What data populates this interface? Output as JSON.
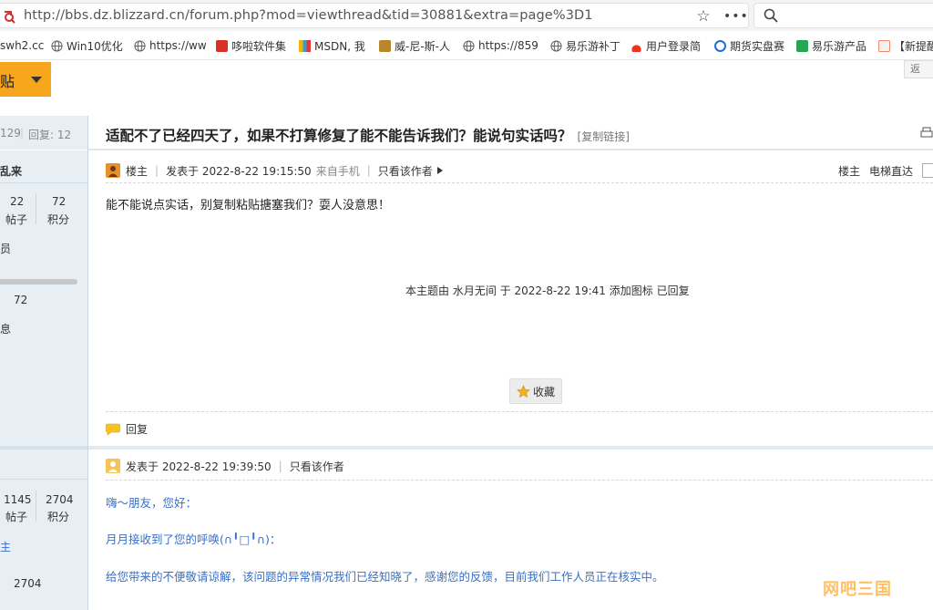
{
  "browser": {
    "url": "http://bbs.dz.blizzard.cn/forum.php?mod=viewthread&tid=30881&extra=page%3D1",
    "more_label": "•••",
    "bookmarks": [
      {
        "label": "swh2.cc",
        "icon": "partial-icon"
      },
      {
        "label": "Win10优化",
        "icon": "globe-icon"
      },
      {
        "label": "https://ww",
        "icon": "globe-icon"
      },
      {
        "label": "哆啦软件集",
        "icon": "duola-icon"
      },
      {
        "label": "MSDN, 我",
        "icon": "msdn-icon"
      },
      {
        "label": "威-尼-斯-人",
        "icon": "ship-icon"
      },
      {
        "label": "https://859",
        "icon": "globe-icon"
      },
      {
        "label": "易乐游补丁",
        "icon": "globe-icon"
      },
      {
        "label": "用户登录简",
        "icon": "huawei-icon"
      },
      {
        "label": "期货实盘赛",
        "icon": "futures-icon"
      },
      {
        "label": "易乐游产品",
        "icon": "green-icon"
      },
      {
        "label": "【新提醒",
        "icon": "site58-icon"
      }
    ]
  },
  "page": {
    "post_button_label": "贴",
    "back_label": "返",
    "thread_title": "适配不了已经四天了，如果不打算修复了能不能告诉我们？能说句实话吗？",
    "copy_link_label": "[复制链接]"
  },
  "sidebar": {
    "views": "129",
    "replies_label": "回复: 12",
    "user1_name_fragment": "乱来",
    "user1_posts": "22",
    "user1_posts_label": "帖子",
    "user1_points": "72",
    "user1_points_label": "积分",
    "user1_group_fragment": "员",
    "user1_stat": "72",
    "user1_msg_fragment": "息",
    "user2_posts": "1145",
    "user2_posts_label": "帖子",
    "user2_points": "2704",
    "user2_points_label": "积分",
    "user2_group_fragment": "主",
    "user2_stat": "2704"
  },
  "post1": {
    "role": "楼主",
    "posted_at": "发表于 2022-8-22 19:15:50",
    "source": "来自手机",
    "only_author": "只看该作者",
    "floor_label": "楼主",
    "jump_label": "电梯直达",
    "content": "能不能说点实话，别复制粘贴搪塞我们？耍人没意思！",
    "edit_note": "本主题由 水月无间 于 2022-8-22 19:41 添加图标 已回复",
    "favorite_label": "收藏",
    "reply_label": "回复"
  },
  "post2": {
    "posted_at": "发表于 2022-8-22 19:39:50",
    "only_author": "只看该作者",
    "lines": [
      "嗨～朋友，您好：",
      "月月接收到了您的呼唤(∩╹□╹∩)：",
      "给您带来的不便敬请谅解，该问题的异常情况我们已经知晓了，感谢您的反馈，目前我们工作人员正在核实中。"
    ]
  },
  "watermark": "网吧三国",
  "colors": {
    "accent_orange": "#f7a51a",
    "sidebar_bg": "#e7eef4",
    "reply_blue": "#3a6fc4"
  }
}
